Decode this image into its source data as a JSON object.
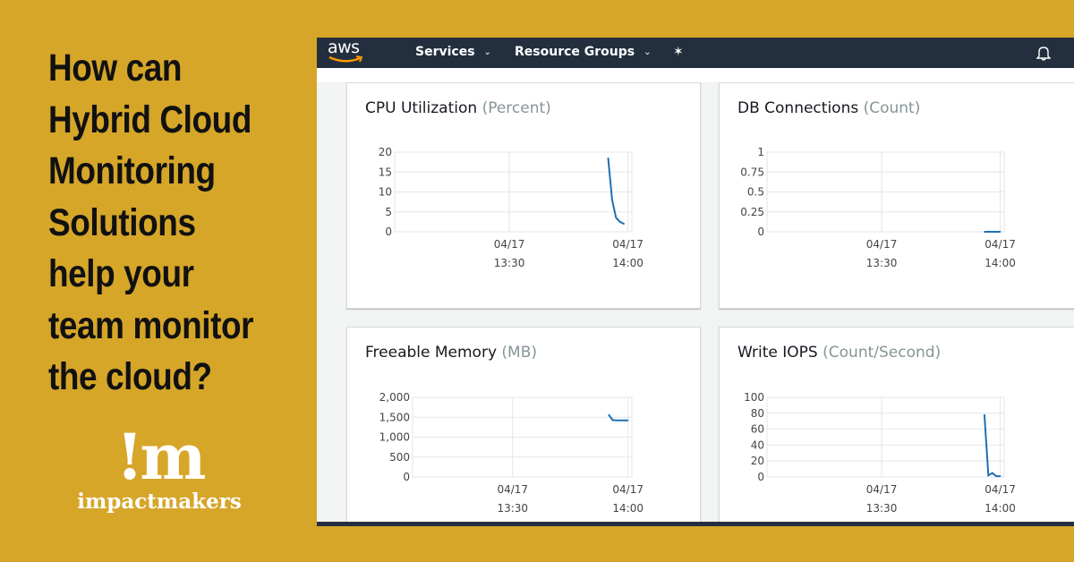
{
  "headline": [
    "How can",
    "Hybrid Cloud",
    "Monitoring",
    "Solutions",
    "help your",
    "team monitor",
    "the cloud?"
  ],
  "logo": {
    "mark": "!m",
    "word": "impactmakers"
  },
  "nav": {
    "brand": "aws",
    "services": "Services",
    "resource_groups": "Resource Groups",
    "pin_icon": "pin-icon",
    "bell_icon": "bell-icon"
  },
  "colors": {
    "background": "#D6A629",
    "navbar": "#232f3e",
    "line": "#1f6fb2",
    "aws_orange": "#ff9900"
  },
  "charts": [
    {
      "title": "CPU Utilization",
      "unit": "(Percent)",
      "type": "line",
      "xlim": [
        "13:01",
        "14:01"
      ],
      "ylim": [
        0,
        20
      ],
      "yticks": [
        "0",
        "5",
        "10",
        "15",
        "20"
      ],
      "ytick_values": [
        0,
        5,
        10,
        15,
        20
      ],
      "xticks": [
        {
          "date": "04/17",
          "time": "13:30"
        },
        {
          "date": "04/17",
          "time": "14:00"
        }
      ],
      "x": [
        "13:55",
        "13:56",
        "13:57",
        "13:58",
        "13:59"
      ],
      "y": [
        18.5,
        8,
        3.5,
        2.5,
        2
      ]
    },
    {
      "title": "DB Connections",
      "unit": "(Count)",
      "type": "line",
      "xlim": [
        "13:01",
        "14:01"
      ],
      "ylim": [
        0,
        1
      ],
      "yticks": [
        "0",
        "0.25",
        "0.5",
        "0.75",
        "1"
      ],
      "ytick_values": [
        0,
        0.25,
        0.5,
        0.75,
        1
      ],
      "xticks": [
        {
          "date": "04/17",
          "time": "13:30"
        },
        {
          "date": "04/17",
          "time": "14:00"
        }
      ],
      "x": [
        "13:56",
        "13:57",
        "13:58",
        "13:59",
        "14:00"
      ],
      "y": [
        0,
        0,
        0,
        0,
        0
      ]
    },
    {
      "title": "Freeable Memory",
      "unit": "(MB)",
      "type": "line",
      "xlim": [
        "13:04",
        "14:01"
      ],
      "ylim": [
        0,
        2000
      ],
      "yticks": [
        "0",
        "500",
        "1,000",
        "1,500",
        "2,000"
      ],
      "ytick_values": [
        0,
        500,
        1000,
        1500,
        2000
      ],
      "xticks": [
        {
          "date": "04/17",
          "time": "13:30"
        },
        {
          "date": "04/17",
          "time": "14:00"
        }
      ],
      "x": [
        "13:55",
        "13:56",
        "13:57",
        "13:58",
        "13:59",
        "14:00"
      ],
      "y": [
        1560,
        1430,
        1420,
        1420,
        1420,
        1420
      ]
    },
    {
      "title": "Write IOPS",
      "unit": "(Count/Second)",
      "type": "line",
      "xlim": [
        "13:01",
        "14:01"
      ],
      "ylim": [
        0,
        100
      ],
      "yticks": [
        "0",
        "20",
        "40",
        "60",
        "80",
        "100"
      ],
      "ytick_values": [
        0,
        20,
        40,
        60,
        80,
        100
      ],
      "xticks": [
        {
          "date": "04/17",
          "time": "13:30"
        },
        {
          "date": "04/17",
          "time": "14:00"
        }
      ],
      "x": [
        "13:56",
        "13:57",
        "13:58",
        "13:59",
        "14:00"
      ],
      "y": [
        78,
        2,
        5,
        1,
        1
      ]
    }
  ]
}
